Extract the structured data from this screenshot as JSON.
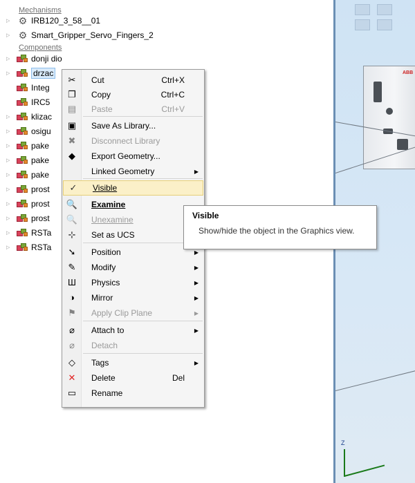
{
  "tree": {
    "mechanisms_header": "Mechanisms",
    "mechanisms": [
      {
        "label": "IRB120_3_58__01",
        "icon": "robot-icon"
      },
      {
        "label": "Smart_Gripper_Servo_Fingers_2",
        "icon": "gripper-icon"
      }
    ],
    "components_header": "Components",
    "components": [
      {
        "label": "donji dio",
        "expandable": true
      },
      {
        "label": "drzac",
        "expandable": true,
        "selected": true
      },
      {
        "label": "Integ",
        "expandable": false
      },
      {
        "label": "IRC5",
        "expandable": false
      },
      {
        "label": "klizac",
        "expandable": true
      },
      {
        "label": "osigu",
        "expandable": true
      },
      {
        "label": "pake",
        "expandable": true
      },
      {
        "label": "pake",
        "expandable": true
      },
      {
        "label": "pake",
        "expandable": true
      },
      {
        "label": "prost",
        "expandable": true
      },
      {
        "label": "prost",
        "expandable": true
      },
      {
        "label": "prost",
        "expandable": true
      },
      {
        "label": "RSTa",
        "expandable": true
      },
      {
        "label": "RSTa",
        "expandable": true
      }
    ]
  },
  "menu": {
    "items": [
      {
        "label": "Cut",
        "shortcut": "Ctrl+X",
        "icon": "scissors-icon",
        "glyph": "✂"
      },
      {
        "label": "Copy",
        "shortcut": "Ctrl+C",
        "icon": "copy-icon",
        "glyph": "❐"
      },
      {
        "label": "Paste",
        "shortcut": "Ctrl+V",
        "icon": "paste-icon",
        "glyph": "▤",
        "disabled": true
      },
      {
        "label": "Save As Library...",
        "icon": "save-library-icon",
        "glyph": "▣"
      },
      {
        "label": "Disconnect Library",
        "icon": "disconnect-icon",
        "glyph": "✖",
        "disabled": true
      },
      {
        "label": "Export Geometry...",
        "icon": "export-icon",
        "glyph": "◆"
      },
      {
        "label": "Linked Geometry",
        "icon": "",
        "glyph": "",
        "submenu": true
      },
      {
        "label": "Visible",
        "icon": "check-icon",
        "glyph": "✓",
        "highlighted": true
      },
      {
        "label": "Examine",
        "icon": "examine-icon",
        "glyph": "🔍",
        "bold": true
      },
      {
        "label": "Unexamine",
        "icon": "unexamine-icon",
        "glyph": "🔍",
        "disabled": true
      },
      {
        "label": "Set as UCS",
        "icon": "ucs-icon",
        "glyph": "⊹"
      },
      {
        "label": "Position",
        "icon": "position-icon",
        "glyph": "➘",
        "submenu": true
      },
      {
        "label": "Modify",
        "icon": "pencil-icon",
        "glyph": "✎",
        "submenu": true
      },
      {
        "label": "Physics",
        "icon": "physics-icon",
        "glyph": "Ш",
        "submenu": true
      },
      {
        "label": "Mirror",
        "icon": "mirror-icon",
        "glyph": "◑",
        "submenu": true
      },
      {
        "label": "Apply Clip Plane",
        "icon": "clip-plane-icon",
        "glyph": "⚑",
        "submenu": true,
        "disabled": true
      },
      {
        "label": "Attach to",
        "icon": "attach-icon",
        "glyph": "⌀",
        "submenu": true
      },
      {
        "label": "Detach",
        "icon": "detach-icon",
        "glyph": "⌀",
        "disabled": true
      },
      {
        "label": "Tags",
        "icon": "tag-icon",
        "glyph": "◇",
        "submenu": true
      },
      {
        "label": "Delete",
        "shortcut": "Del",
        "icon": "delete-icon",
        "glyph": "✕"
      },
      {
        "label": "Rename",
        "icon": "rename-icon",
        "glyph": "▭"
      }
    ]
  },
  "tooltip": {
    "title": "Visible",
    "description": "Show/hide the object in the Graphics view."
  },
  "graphics": {
    "axis_label": "Z",
    "brand": "ABB"
  },
  "colors": {
    "highlight": "#fbf0c8",
    "delete_icon": "#e02020",
    "selection": "#d9ebfb"
  }
}
